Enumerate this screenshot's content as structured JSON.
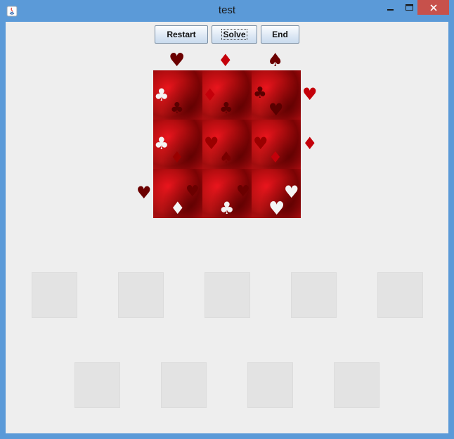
{
  "window": {
    "title": "test"
  },
  "toolbar": {
    "restart_label": "Restart",
    "solve_label": "Solve",
    "end_label": "End"
  },
  "colors": {
    "dark_red": "#6b0000",
    "red": "#c4000a",
    "white": "#f4f4f4",
    "close_red": "#c7514b",
    "titlebar": "#5b9ad8"
  },
  "icons": {
    "minimize": "minimize-icon",
    "maximize": "maximize-icon",
    "close": "close-icon",
    "app": "java-app-icon"
  },
  "board": {
    "rows": 3,
    "cols": 3
  },
  "tray": {
    "row1_slots": 5,
    "row2_slots": 4
  }
}
